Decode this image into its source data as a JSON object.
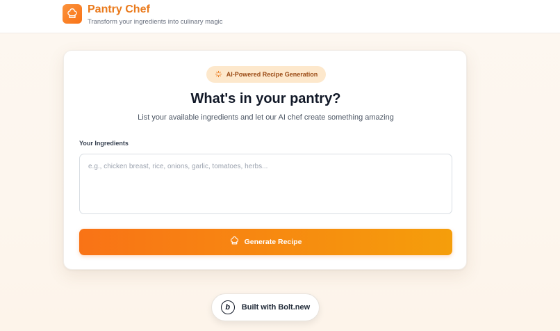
{
  "header": {
    "app_name": "Pantry Chef",
    "tagline": "Transform your ingredients into culinary magic",
    "logo_icon": "chef-hat-icon"
  },
  "card": {
    "badge_label": "AI-Powered Recipe Generation",
    "badge_icon": "sparkles-icon",
    "title": "What's in your pantry?",
    "description": "List your available ingredients and let our AI chef create something amazing",
    "ingredients_label": "Your Ingredients",
    "ingredients_value": "",
    "ingredients_placeholder": "e.g., chicken breast, rice, onions, garlic, tomatoes, herbs...",
    "generate_button_label": "Generate Recipe",
    "generate_button_icon": "chef-hat-icon"
  },
  "footer": {
    "bolt_label": "Built with Bolt.new",
    "bolt_logo_letter": "b"
  },
  "colors": {
    "accent": "#f97316",
    "accent_end": "#f59e0b",
    "brand_text": "#ea7a1c",
    "badge_bg": "#fde8cc",
    "badge_text": "#9a4a14"
  }
}
